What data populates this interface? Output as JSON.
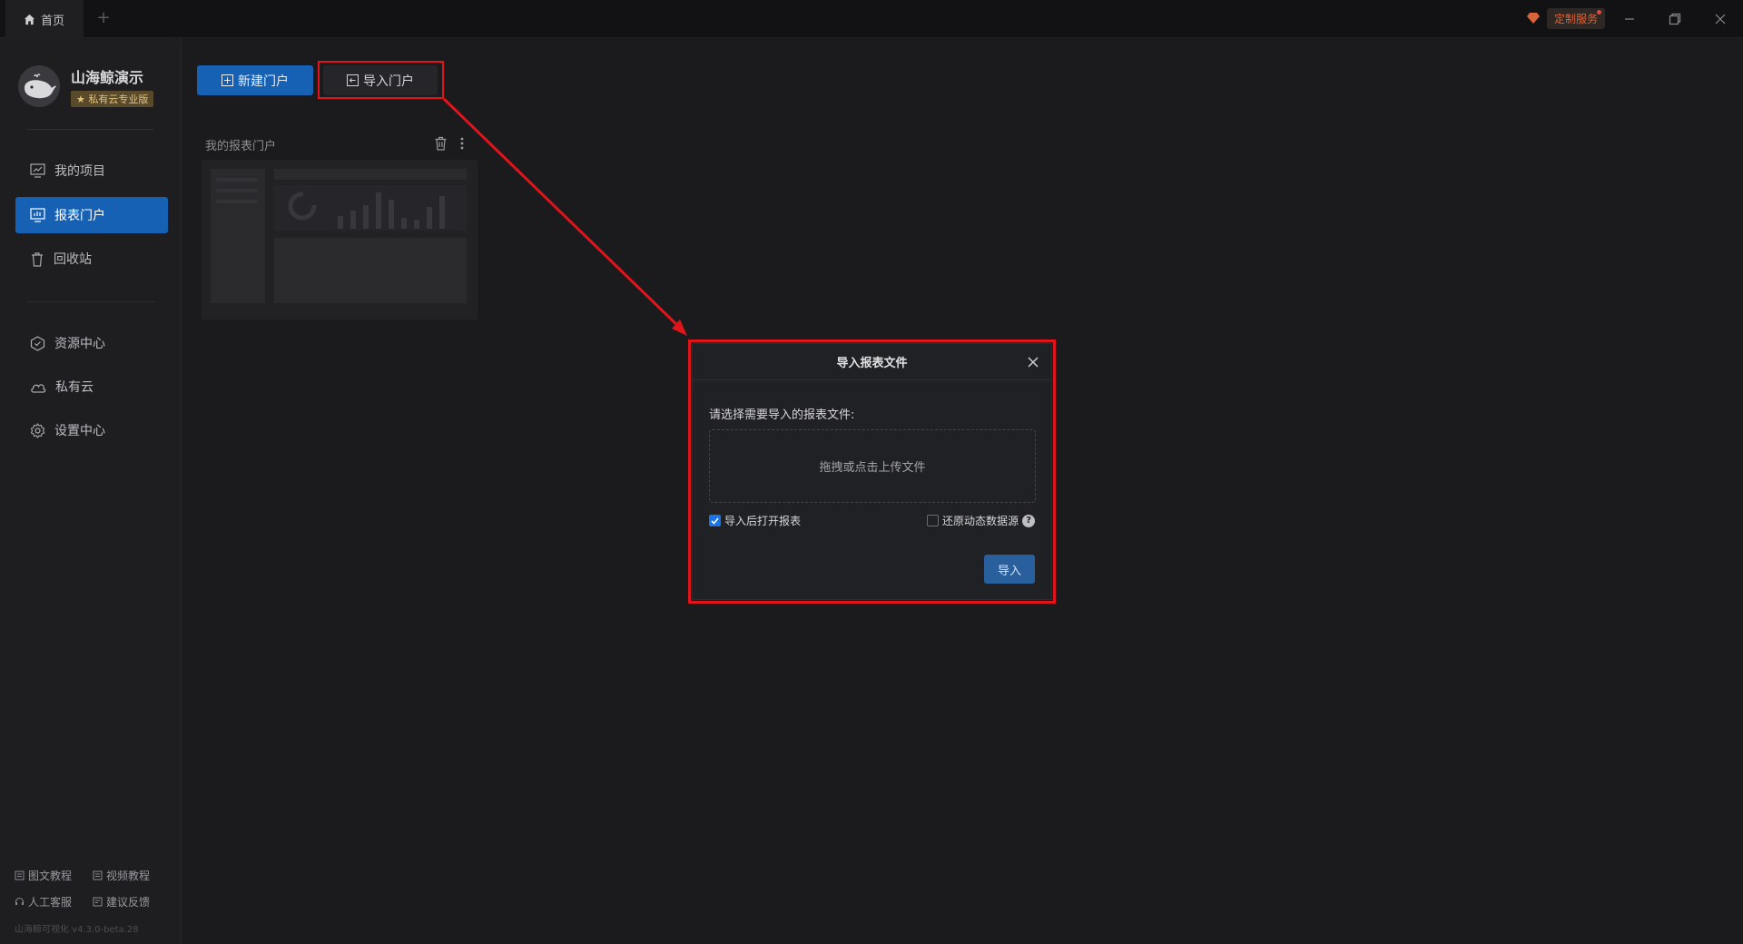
{
  "titlebar": {
    "home_tab": "首页",
    "add_tab": "+",
    "custom_service": "定制服务"
  },
  "sidebar": {
    "app_name": "山海鲸演示",
    "edition": "私有云专业版",
    "nav": [
      {
        "label": "我的项目",
        "icon": "project-icon"
      },
      {
        "label": "报表门户",
        "icon": "report-portal-icon",
        "active": true
      },
      {
        "label": "回收站",
        "icon": "trash-icon"
      },
      {
        "label": "资源中心",
        "icon": "resource-icon"
      },
      {
        "label": "私有云",
        "icon": "cloud-icon"
      },
      {
        "label": "设置中心",
        "icon": "settings-icon"
      }
    ],
    "footer": {
      "tutorial": "图文教程",
      "video": "视频教程",
      "support": "人工客服",
      "feedback": "建议反馈",
      "version": "山海鲸可视化 v4.3.0-beta.28"
    }
  },
  "main": {
    "new_portal": "新建门户",
    "import_portal": "导入门户",
    "card_title": "我的报表门户"
  },
  "dialog": {
    "title": "导入报表文件",
    "prompt": "请选择需要导入的报表文件:",
    "upload_hint": "拖拽或点击上传文件",
    "open_after_import": "导入后打开报表",
    "open_after_import_checked": true,
    "restore_datasource": "还原动态数据源",
    "restore_datasource_checked": false,
    "help": "?",
    "submit": "导入"
  },
  "colors": {
    "accent": "#1761b5",
    "highlight": "#e0141b",
    "background": "#1b1b1d"
  }
}
